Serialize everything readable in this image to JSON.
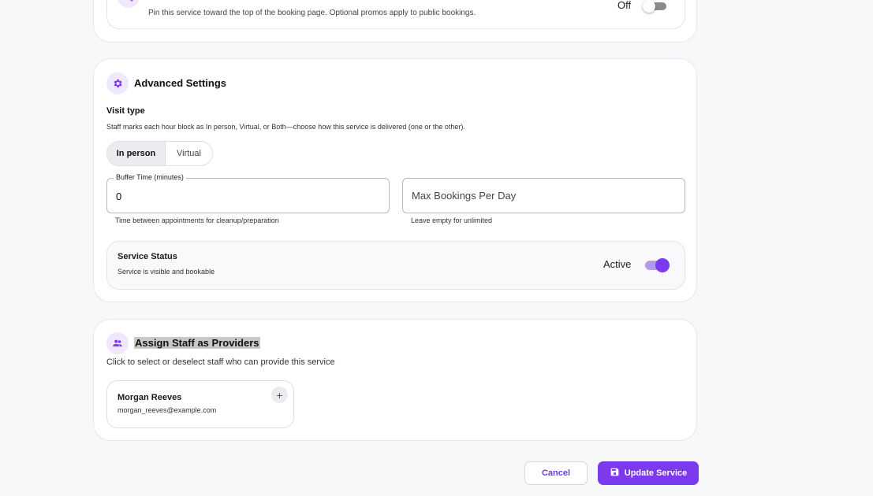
{
  "promo_section": {
    "description": "Pin this service toward the top of the booking page. Optional promos apply to public bookings.",
    "toggle_state": "Off",
    "icon": "sparkle-icon"
  },
  "advanced": {
    "title": "Advanced Settings",
    "icon": "gear-icon",
    "visit_type_label": "Visit type",
    "visit_type_help": "Staff marks each hour block as In person, Virtual, or Both—choose how this service is delivered (one or the other).",
    "visit_options": [
      "In person",
      "Virtual"
    ],
    "visit_selected": "In person",
    "buffer_label": "Buffer Time (minutes)",
    "buffer_value": "0",
    "buffer_help": "Time between appointments for cleanup/preparation",
    "max_placeholder": "Max Bookings Per Day",
    "max_help": "Leave empty for unlimited",
    "status_title": "Service Status",
    "status_desc": "Service is visible and bookable",
    "status_state": "Active"
  },
  "staff": {
    "title": "Assign Staff as Providers",
    "icon": "people-icon",
    "subtitle": "Click to select or deselect staff who can provide this service",
    "members": [
      {
        "name": "Morgan Reeves",
        "email": "morgan_reeves@example.com"
      }
    ]
  },
  "actions": {
    "cancel_label": "Cancel",
    "update_label": "Update Service"
  },
  "colors": {
    "accent": "#7c3aed",
    "accent_light": "#efe8fb"
  }
}
